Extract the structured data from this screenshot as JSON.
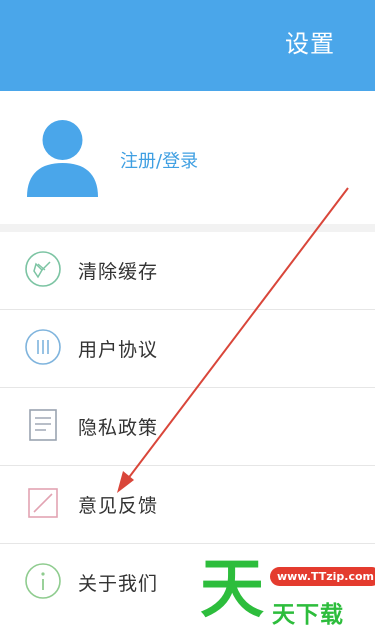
{
  "header": {
    "title": "设置"
  },
  "profile": {
    "login_label": "注册/登录"
  },
  "menu": {
    "items": [
      {
        "label": "清除缓存",
        "icon": "broom-icon"
      },
      {
        "label": "用户协议",
        "icon": "agreement-icon"
      },
      {
        "label": "隐私政策",
        "icon": "document-icon"
      },
      {
        "label": "意见反馈",
        "icon": "feedback-edit-icon"
      },
      {
        "label": "关于我们",
        "icon": "info-icon"
      }
    ]
  },
  "watermark": {
    "big_char": "天",
    "url": "www.TTzip.com",
    "text": "天下载"
  },
  "colors": {
    "header": "#4aa6ea",
    "link": "#3f9fe2",
    "arrow": "#d9463a",
    "watermark_green": "#2dbd3c",
    "watermark_red": "#e43b2e"
  }
}
